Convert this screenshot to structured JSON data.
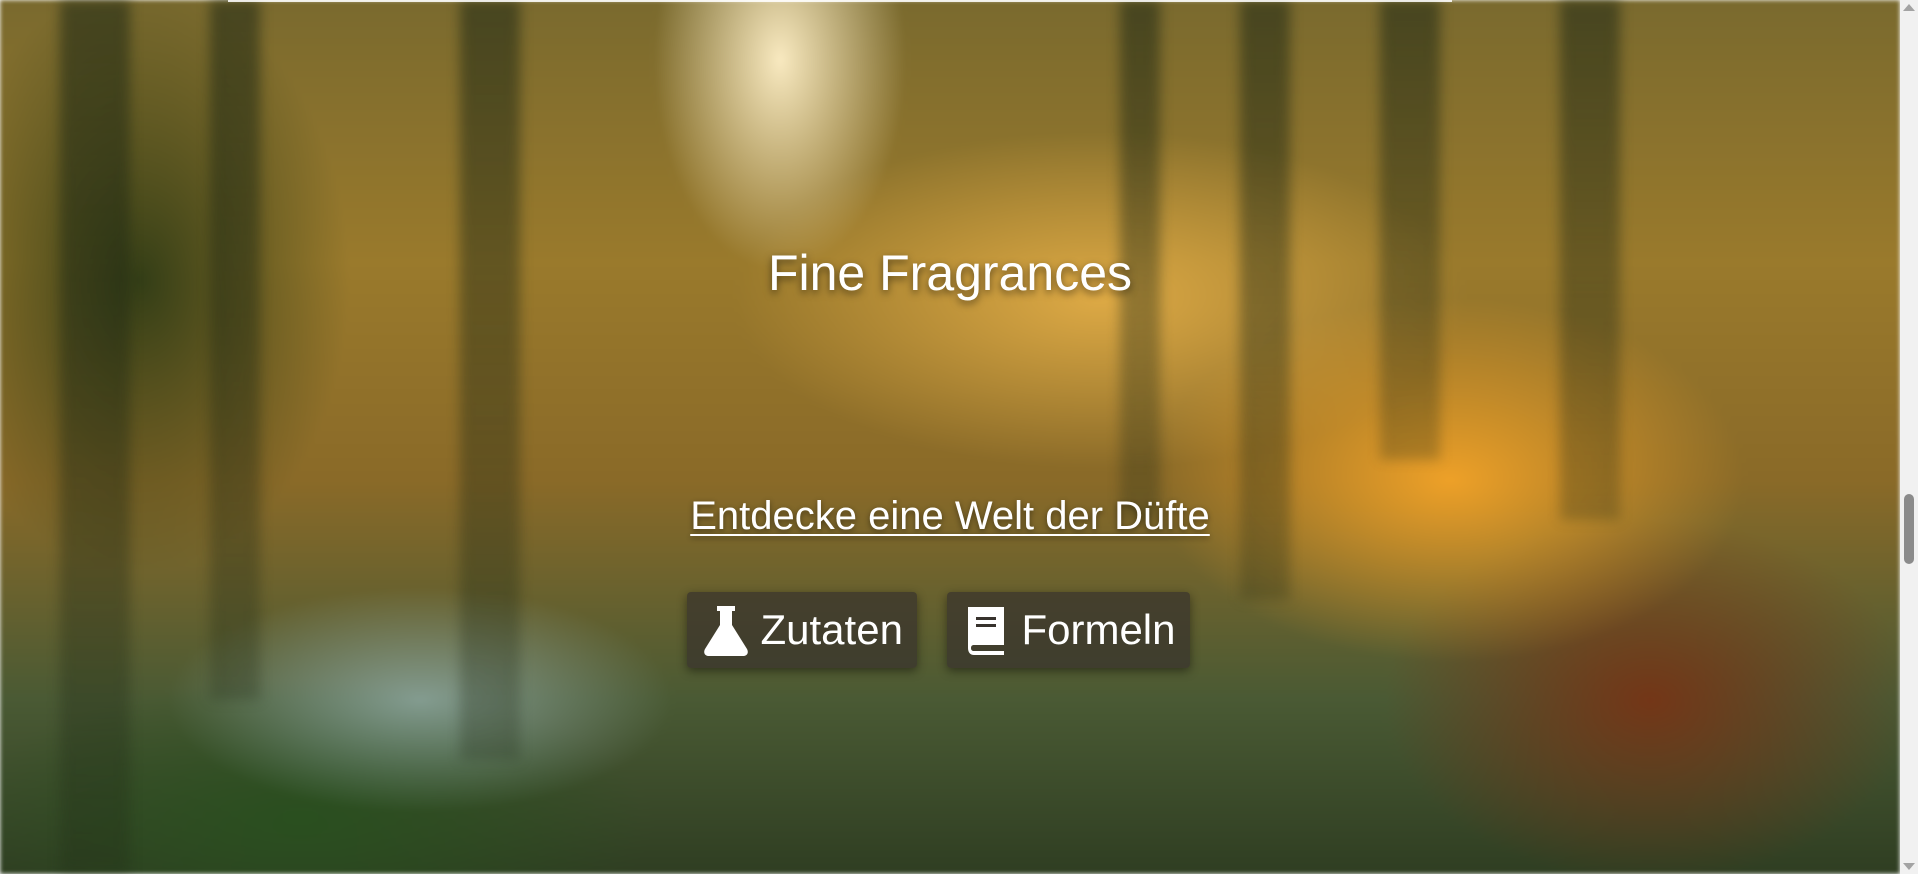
{
  "hero": {
    "title": "Fine Fragrances",
    "tagline": "Entdecke eine Welt der Düfte"
  },
  "buttons": {
    "ingredients": {
      "label": "Zutaten",
      "icon": "flask-icon"
    },
    "formulas": {
      "label": "Formeln",
      "icon": "book-icon"
    }
  },
  "colors": {
    "text": "#ffffff",
    "button_bg": "#37322d"
  }
}
